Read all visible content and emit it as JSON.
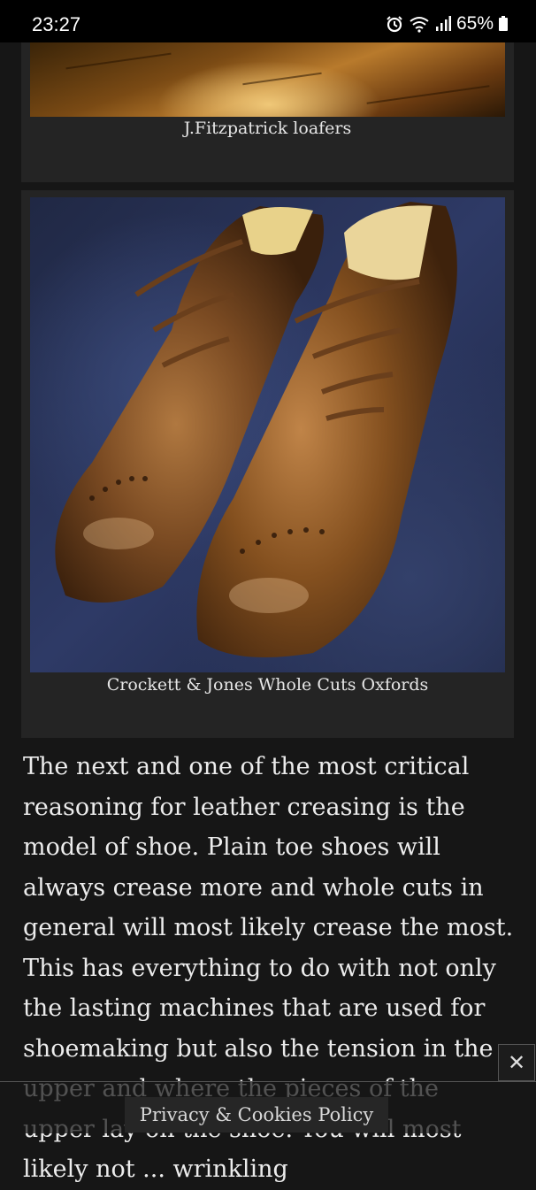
{
  "status_bar": {
    "time": "23:27",
    "battery": "65%",
    "icons": [
      "alarm-icon",
      "wifi-icon",
      "signal-icon",
      "battery-icon"
    ]
  },
  "figures": [
    {
      "image": "loafers-photo",
      "caption": "J.Fitzpatrick loafers"
    },
    {
      "image": "oxford-shoes-photo",
      "caption": "Crockett & Jones Whole Cuts Oxfords"
    }
  ],
  "article": {
    "paragraph": "The next and one of the most critical reasoning for leather creasing is the model of shoe. Plain toe shoes will always crease more and whole cuts in general will most likely crease the most. This has everything to do with not only the lasting machines that are used for shoemaking but also the tension in the upper and where the pieces of the upper lay on the shoe. You will most likely not ... wrinkling"
  },
  "overlay": {
    "close_label": "✕",
    "privacy_label": "Privacy & Cookies Policy"
  }
}
